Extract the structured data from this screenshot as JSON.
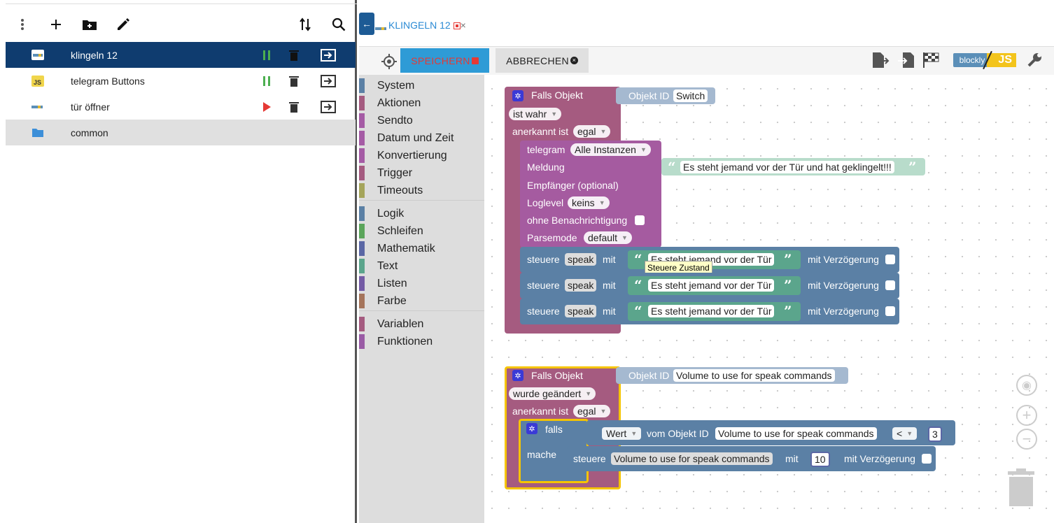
{
  "colors": {
    "accent": "#0f3c6f",
    "save": "#2e9bd6",
    "event": "#a55b80",
    "telegram": "#a55ba0",
    "control": "#5b80a5",
    "text": "#5ba58c",
    "objid": "#a5b9d0"
  },
  "left_toolbar": {
    "icons": [
      "more-vert-icon",
      "add-icon",
      "create-folder-icon",
      "edit-icon",
      "sort-icon",
      "search-icon"
    ]
  },
  "scripts": [
    {
      "name": "klingeln 12",
      "type": "blockly",
      "state": "running"
    },
    {
      "name": "telegram Buttons",
      "type": "js",
      "state": "running"
    },
    {
      "name": "tür öffner",
      "type": "blockly",
      "state": "stopped"
    },
    {
      "name": "common",
      "type": "folder",
      "state": ""
    }
  ],
  "tab": {
    "title": "KLINGELN 12",
    "close": "×"
  },
  "actions": {
    "save": "SPEICHERN",
    "cancel": "ABBRECHEN"
  },
  "toolbar_right": {
    "blockly_label": "blockly",
    "js_label": "JS"
  },
  "toolbox": [
    "System",
    "Aktionen",
    "Sendto",
    "Datum und Zeit",
    "Konvertierung",
    "Trigger",
    "Timeouts",
    "Logik",
    "Schleifen",
    "Mathematik",
    "Text",
    "Listen",
    "Farbe",
    "Variablen",
    "Funktionen"
  ],
  "block1": {
    "head": "Falls Objekt",
    "objid_label": "Objekt ID",
    "objid_value": "Switch",
    "cond": "ist wahr",
    "ack_label": "anerkannt ist",
    "ack_value": "egal",
    "telegram": "telegram",
    "tg_instance": "Alle Instanzen",
    "meldung": "Meldung",
    "message": "Es steht jemand vor der Tür und hat geklingelt!!!",
    "empfaenger": "Empfänger (optional)",
    "loglevel": "Loglevel",
    "loglevel_value": "keins",
    "silent": "ohne Benachrichtigung",
    "parsemode": "Parsemode",
    "parsemode_value": "default",
    "steuere": "steuere",
    "speak": "speak",
    "mit": "mit",
    "speak_text": "Es steht jemand vor der Tür",
    "delay": "mit Verzögerung",
    "tooltip": "Steuere Zustand"
  },
  "block2": {
    "head": "Falls Objekt",
    "objid_label": "Objekt ID",
    "objid_value": "Volume to use for speak commands",
    "cond": "wurde geändert",
    "ack_label": "anerkannt ist",
    "ack_value": "egal",
    "falls": "falls",
    "mache": "mache",
    "wert": "Wert",
    "vom": "vom Objekt ID",
    "obj": "Volume to use for speak commands",
    "op": "<",
    "num": "3",
    "steuere": "steuere",
    "target": "Volume to use for speak commands",
    "mit": "mit",
    "value": "10",
    "delay": "mit Verzögerung"
  }
}
